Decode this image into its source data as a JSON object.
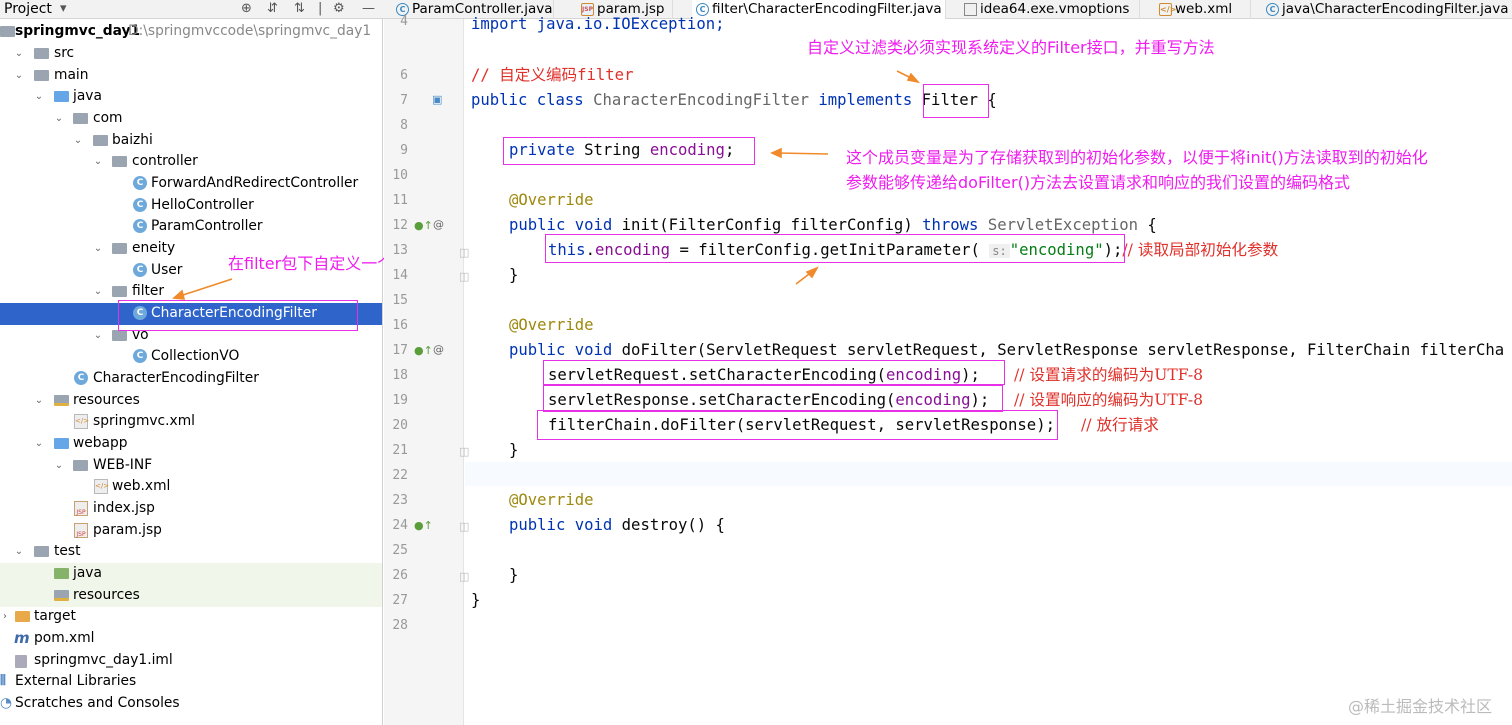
{
  "project_panel": {
    "title": "Project",
    "tree": [
      {
        "label": "springmvc_day1",
        "path": "D:\\springmvccode\\springmvc_day1"
      },
      {
        "label": "src"
      },
      {
        "label": "main"
      },
      {
        "label": "java"
      },
      {
        "label": "com"
      },
      {
        "label": "baizhi"
      },
      {
        "label": "controller"
      },
      {
        "label": "ForwardAndRedirectController"
      },
      {
        "label": "HelloController"
      },
      {
        "label": "ParamController"
      },
      {
        "label": "eneity"
      },
      {
        "label": "User"
      },
      {
        "label": "filter"
      },
      {
        "label": "CharacterEncodingFilter"
      },
      {
        "label": "vo"
      },
      {
        "label": "CollectionVO"
      },
      {
        "label": "CharacterEncodingFilter"
      },
      {
        "label": "resources"
      },
      {
        "label": "springmvc.xml"
      },
      {
        "label": "webapp"
      },
      {
        "label": "WEB-INF"
      },
      {
        "label": "web.xml"
      },
      {
        "label": "index.jsp"
      },
      {
        "label": "param.jsp"
      },
      {
        "label": "test"
      },
      {
        "label": "java"
      },
      {
        "label": "resources"
      },
      {
        "label": "target"
      },
      {
        "label": "pom.xml"
      },
      {
        "label": "springmvc_day1.iml"
      },
      {
        "label": "External Libraries"
      },
      {
        "label": "Scratches and Consoles"
      }
    ]
  },
  "tabs": [
    {
      "label": "ParamController.java"
    },
    {
      "label": "param.jsp"
    },
    {
      "label": "filter\\CharacterEncodingFilter.java"
    },
    {
      "label": "idea64.exe.vmoptions"
    },
    {
      "label": "web.xml"
    },
    {
      "label": "java\\CharacterEncodingFilter.java"
    }
  ],
  "editor": {
    "line_numbers": [
      "4",
      "6",
      "7",
      "8",
      "9",
      "10",
      "11",
      "12",
      "13",
      "14",
      "15",
      "16",
      "17",
      "18",
      "19",
      "20",
      "21",
      "22",
      "23",
      "24",
      "25",
      "26",
      "27",
      "28"
    ],
    "code": {
      "l4": "import java.io.IOException;",
      "l6": "// 自定义编码filter",
      "l7a": "public class ",
      "l7b": "CharacterEncodingFilter",
      "l7c": " implements ",
      "l7d": "Filter",
      "l7e": " {",
      "l9a": "private ",
      "l9b": "String ",
      "l9c": "encoding",
      "l9d": ";",
      "l11": "@Override",
      "l12a": "public void ",
      "l12b": "init(FilterConfig filterConfig) ",
      "l12c": "throws ",
      "l12d": "ServletException",
      "l12e": " {",
      "l13a": "this",
      "l13b": ".",
      "l13c": "encoding",
      "l13d": " = filterConfig.getInitParameter( ",
      "l13hint": "s:",
      "l13e": "\"encoding\"",
      "l13f": ");",
      "l13cm": "// 读取局部初始化参数",
      "l14": "}",
      "l16": "@Override",
      "l17a": "public void ",
      "l17b": "doFilter(ServletRequest servletRequest, ServletResponse servletResponse, FilterChain filterCha",
      "l18a": "servletRequest.setCharacterEncoding(",
      "l18b": "encoding",
      "l18c": ");",
      "l18cm": "// 设置请求的编码为UTF-8",
      "l19a": "servletResponse.setCharacterEncoding(",
      "l19b": "encoding",
      "l19c": ");",
      "l19cm": "// 设置响应的编码为UTF-8",
      "l20a": "filterChain.doFilter(servletRequest, servletResponse);",
      "l20cm": "// 放行请求",
      "l21": "}",
      "l23": "@Override",
      "l24a": "public void ",
      "l24b": "destroy() {",
      "l26": "}",
      "l27": "}"
    }
  },
  "annotations": {
    "filter_interface": "自定义过滤类必须实现系统定义的Filter接口，并重写方法",
    "member_var_1": "这个成员变量是为了存储获取到的初始化参数，以便于将init()方法读取到的初始化",
    "member_var_2": "参数能够传递给doFilter()方法去设置请求和响应的我们设置的编码格式",
    "filter_pkg": "在filter包下自定义一个过滤类"
  },
  "watermark": "@稀土掘金技术社区",
  "colors": {
    "annotation": "#ee1cee",
    "selection": "#2f65ca",
    "keyword": "#0033b3"
  }
}
